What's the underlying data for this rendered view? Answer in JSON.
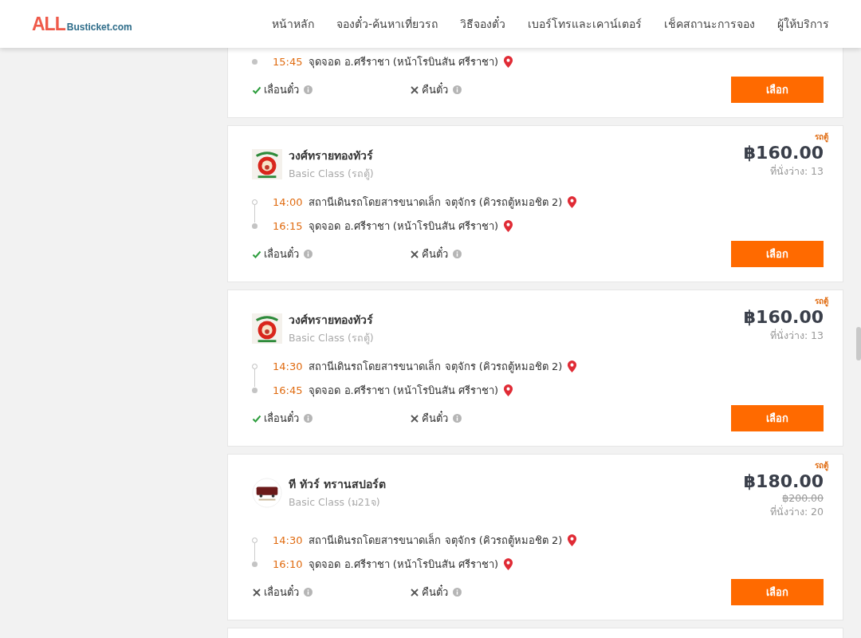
{
  "header": {
    "logo_main": "ALL",
    "logo_sub": "Busticket.com",
    "nav": [
      {
        "label": "หน้าหลัก"
      },
      {
        "label": "จองตั๋ว-ค้นหาเที่ยวรถ"
      },
      {
        "label": "วิธีจองตั๋ว"
      },
      {
        "label": "เบอร์โทรและเคาน์เตอร์"
      },
      {
        "label": "เช็คสถานะการจอง"
      },
      {
        "label": "ผู้ให้บริการ"
      }
    ]
  },
  "trips": [
    {
      "kind": "partial",
      "arrive_time": "15:45",
      "arrive_stop": "จุดจอด อ.ศรีราชา (หน้าโรบินสัน ศรีราชา)",
      "policies": [
        {
          "label": "เลื่อนตั๋ว",
          "allowed": true
        },
        {
          "label": "คืนตั๋ว",
          "allowed": false
        }
      ],
      "button": "เลือก"
    },
    {
      "kind": "full",
      "vehicle": "รถตู้",
      "logo": {
        "kind": "lion"
      },
      "company": "วงศ์ทรายทองทัวร์",
      "class": "Basic Class (รถตู้)",
      "price": "฿160.00",
      "seats": "ที่นั่งว่าง: 13",
      "depart_time": "14:00",
      "depart_stop": "สถานีเดินรถโดยสารขนาดเล็ก จตุจักร (คิวรถตู้หมอชิต 2)",
      "arrive_time": "16:15",
      "arrive_stop": "จุดจอด อ.ศรีราชา (หน้าโรบินสัน ศรีราชา)",
      "policies": [
        {
          "label": "เลื่อนตั๋ว",
          "allowed": true
        },
        {
          "label": "คืนตั๋ว",
          "allowed": false
        }
      ],
      "button": "เลือก"
    },
    {
      "kind": "full",
      "vehicle": "รถตู้",
      "logo": {
        "kind": "lion"
      },
      "company": "วงศ์ทรายทองทัวร์",
      "class": "Basic Class (รถตู้)",
      "price": "฿160.00",
      "seats": "ที่นั่งว่าง: 13",
      "depart_time": "14:30",
      "depart_stop": "สถานีเดินรถโดยสารขนาดเล็ก จตุจักร (คิวรถตู้หมอชิต 2)",
      "arrive_time": "16:45",
      "arrive_stop": "จุดจอด อ.ศรีราชา (หน้าโรบินสัน ศรีราชา)",
      "policies": [
        {
          "label": "เลื่อนตั๋ว",
          "allowed": true
        },
        {
          "label": "คืนตั๋ว",
          "allowed": false
        }
      ],
      "button": "เลือก"
    },
    {
      "kind": "full",
      "vehicle": "รถตู้",
      "logo": {
        "kind": "bus"
      },
      "company": "ที ทัวร์ ทรานสปอร์ต",
      "class": "Basic Class (ม21จ)",
      "price": "฿180.00",
      "old_price": "฿200.00",
      "seats": "ที่นั่งว่าง: 20",
      "depart_time": "14:30",
      "depart_stop": "สถานีเดินรถโดยสารขนาดเล็ก จตุจักร (คิวรถตู้หมอชิต 2)",
      "arrive_time": "16:10",
      "arrive_stop": "จุดจอด อ.ศรีราชา (หน้าโรบินสัน ศรีราชา)",
      "policies": [
        {
          "label": "เลื่อนตั๋ว",
          "allowed": false
        },
        {
          "label": "คืนตั๋ว",
          "allowed": false
        }
      ],
      "button": "เลือก"
    }
  ]
}
